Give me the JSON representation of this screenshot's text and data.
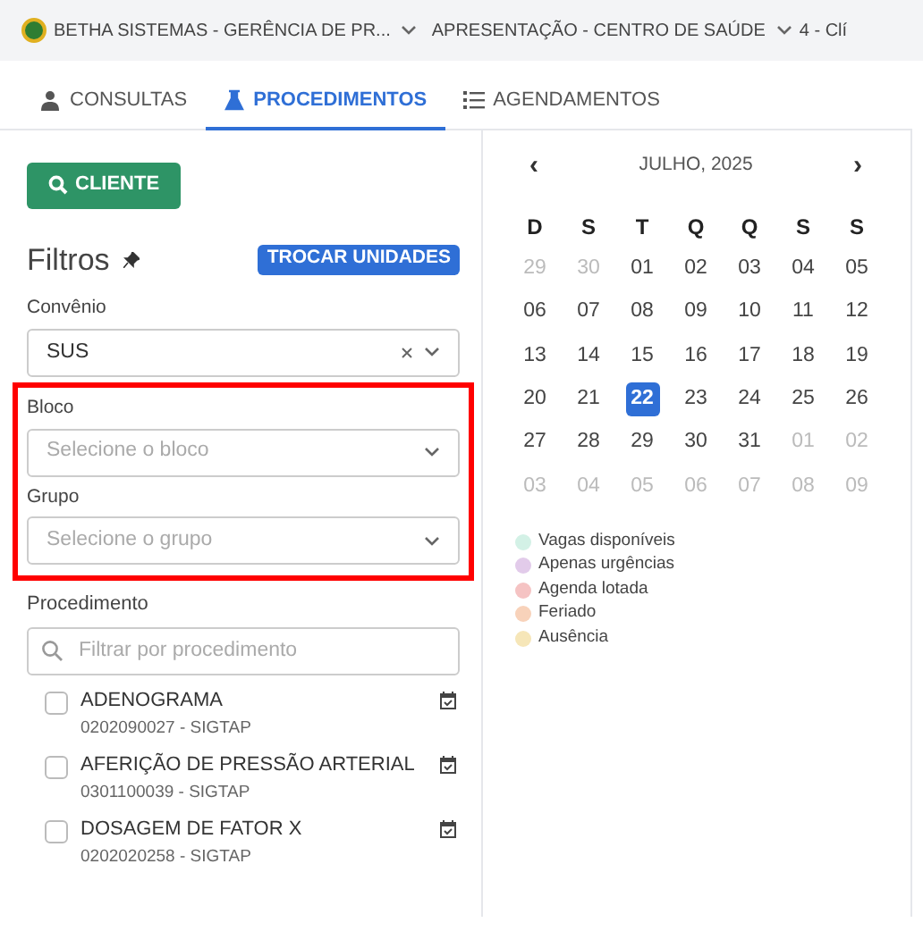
{
  "top_bar": {
    "items": [
      {
        "label": "BETHA SISTEMAS - GERÊNCIA DE PR...",
        "kind": "org"
      },
      {
        "label": "APRESENTAÇÃO - CENTRO DE SAÚDE",
        "kind": "unit"
      },
      {
        "label": "4 - Clí",
        "kind": "clip"
      }
    ]
  },
  "tabs": [
    {
      "label": "CONSULTAS",
      "selected": false
    },
    {
      "label": "PROCEDIMENTOS",
      "selected": true
    },
    {
      "label": "AGENDAMENTOS",
      "selected": false
    }
  ],
  "client_button": "CLIENTE",
  "filters": {
    "title": "Filtros",
    "switch_button": "TROCAR UNIDADES",
    "fields": [
      {
        "label": "Convênio",
        "value": "SUS",
        "clearable": true,
        "highlighted": false
      },
      {
        "label": "Bloco",
        "placeholder": "Selecione o bloco",
        "clearable": false,
        "highlighted": true
      },
      {
        "label": "Grupo",
        "placeholder": "Selecione o grupo",
        "clearable": false,
        "highlighted": true
      }
    ],
    "procedure_label": "Procedimento",
    "procedure_search": {
      "placeholder": "Filtrar por procedimento"
    },
    "procedures": [
      {
        "name": "ADENOGRAMA",
        "code": "0202090027 - SIGTAP",
        "checked": false
      },
      {
        "name": "AFERIÇÃO DE PRESSÃO ARTERIAL",
        "code": "0301100039 - SIGTAP",
        "checked": false
      },
      {
        "name": "DOSAGEM DE FATOR X",
        "code": "0202020258 - SIGTAP",
        "checked": false
      }
    ]
  },
  "calendar": {
    "prev": "‹",
    "month": "JULHO, 2025",
    "next": "›",
    "weekdays": [
      "D",
      "S",
      "T",
      "Q",
      "Q",
      "S",
      "S"
    ],
    "days": [
      {
        "label": "29",
        "muted": true,
        "selected": false
      },
      {
        "label": "30",
        "muted": true,
        "selected": false
      },
      {
        "label": "01",
        "muted": false,
        "selected": false
      },
      {
        "label": "02",
        "muted": false,
        "selected": false
      },
      {
        "label": "03",
        "muted": false,
        "selected": false
      },
      {
        "label": "04",
        "muted": false,
        "selected": false
      },
      {
        "label": "05",
        "muted": false,
        "selected": false
      },
      {
        "label": "06",
        "muted": false,
        "selected": false
      },
      {
        "label": "07",
        "muted": false,
        "selected": false
      },
      {
        "label": "08",
        "muted": false,
        "selected": false
      },
      {
        "label": "09",
        "muted": false,
        "selected": false
      },
      {
        "label": "10",
        "muted": false,
        "selected": false
      },
      {
        "label": "11",
        "muted": false,
        "selected": false
      },
      {
        "label": "12",
        "muted": false,
        "selected": false
      },
      {
        "label": "13",
        "muted": false,
        "selected": false
      },
      {
        "label": "14",
        "muted": false,
        "selected": false
      },
      {
        "label": "15",
        "muted": false,
        "selected": false
      },
      {
        "label": "16",
        "muted": false,
        "selected": false
      },
      {
        "label": "17",
        "muted": false,
        "selected": false
      },
      {
        "label": "18",
        "muted": false,
        "selected": false
      },
      {
        "label": "19",
        "muted": false,
        "selected": false
      },
      {
        "label": "20",
        "muted": false,
        "selected": false
      },
      {
        "label": "21",
        "muted": false,
        "selected": false
      },
      {
        "label": "22",
        "muted": false,
        "selected": true
      },
      {
        "label": "23",
        "muted": false,
        "selected": false
      },
      {
        "label": "24",
        "muted": false,
        "selected": false
      },
      {
        "label": "25",
        "muted": false,
        "selected": false
      },
      {
        "label": "26",
        "muted": false,
        "selected": false
      },
      {
        "label": "27",
        "muted": false,
        "selected": false
      },
      {
        "label": "28",
        "muted": false,
        "selected": false
      },
      {
        "label": "29",
        "muted": false,
        "selected": false
      },
      {
        "label": "30",
        "muted": false,
        "selected": false
      },
      {
        "label": "31",
        "muted": false,
        "selected": false
      },
      {
        "label": "01",
        "muted": true,
        "selected": false
      },
      {
        "label": "02",
        "muted": true,
        "selected": false
      },
      {
        "label": "03",
        "muted": true,
        "selected": false
      },
      {
        "label": "04",
        "muted": true,
        "selected": false
      },
      {
        "label": "05",
        "muted": true,
        "selected": false
      },
      {
        "label": "06",
        "muted": true,
        "selected": false
      },
      {
        "label": "07",
        "muted": true,
        "selected": false
      },
      {
        "label": "08",
        "muted": true,
        "selected": false
      },
      {
        "label": "09",
        "muted": true,
        "selected": false
      }
    ],
    "legend": [
      {
        "label": "Vagas disponíveis",
        "color": "#d3f1e6"
      },
      {
        "label": "Apenas urgências",
        "color": "#e2cbea"
      },
      {
        "label": "Agenda lotada",
        "color": "#f5c3c3"
      },
      {
        "label": "Feriado",
        "color": "#f8d2ba"
      },
      {
        "label": "Ausência",
        "color": "#f6e6b8"
      }
    ]
  }
}
